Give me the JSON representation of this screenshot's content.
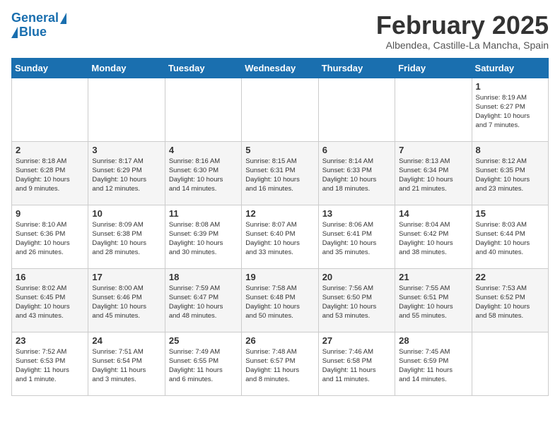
{
  "header": {
    "logo_line1": "General",
    "logo_line2": "Blue",
    "month": "February 2025",
    "location": "Albendea, Castille-La Mancha, Spain"
  },
  "days_of_week": [
    "Sunday",
    "Monday",
    "Tuesday",
    "Wednesday",
    "Thursday",
    "Friday",
    "Saturday"
  ],
  "weeks": [
    [
      {
        "day": "",
        "info": ""
      },
      {
        "day": "",
        "info": ""
      },
      {
        "day": "",
        "info": ""
      },
      {
        "day": "",
        "info": ""
      },
      {
        "day": "",
        "info": ""
      },
      {
        "day": "",
        "info": ""
      },
      {
        "day": "1",
        "info": "Sunrise: 8:19 AM\nSunset: 6:27 PM\nDaylight: 10 hours\nand 7 minutes."
      }
    ],
    [
      {
        "day": "2",
        "info": "Sunrise: 8:18 AM\nSunset: 6:28 PM\nDaylight: 10 hours\nand 9 minutes."
      },
      {
        "day": "3",
        "info": "Sunrise: 8:17 AM\nSunset: 6:29 PM\nDaylight: 10 hours\nand 12 minutes."
      },
      {
        "day": "4",
        "info": "Sunrise: 8:16 AM\nSunset: 6:30 PM\nDaylight: 10 hours\nand 14 minutes."
      },
      {
        "day": "5",
        "info": "Sunrise: 8:15 AM\nSunset: 6:31 PM\nDaylight: 10 hours\nand 16 minutes."
      },
      {
        "day": "6",
        "info": "Sunrise: 8:14 AM\nSunset: 6:33 PM\nDaylight: 10 hours\nand 18 minutes."
      },
      {
        "day": "7",
        "info": "Sunrise: 8:13 AM\nSunset: 6:34 PM\nDaylight: 10 hours\nand 21 minutes."
      },
      {
        "day": "8",
        "info": "Sunrise: 8:12 AM\nSunset: 6:35 PM\nDaylight: 10 hours\nand 23 minutes."
      }
    ],
    [
      {
        "day": "9",
        "info": "Sunrise: 8:10 AM\nSunset: 6:36 PM\nDaylight: 10 hours\nand 26 minutes."
      },
      {
        "day": "10",
        "info": "Sunrise: 8:09 AM\nSunset: 6:38 PM\nDaylight: 10 hours\nand 28 minutes."
      },
      {
        "day": "11",
        "info": "Sunrise: 8:08 AM\nSunset: 6:39 PM\nDaylight: 10 hours\nand 30 minutes."
      },
      {
        "day": "12",
        "info": "Sunrise: 8:07 AM\nSunset: 6:40 PM\nDaylight: 10 hours\nand 33 minutes."
      },
      {
        "day": "13",
        "info": "Sunrise: 8:06 AM\nSunset: 6:41 PM\nDaylight: 10 hours\nand 35 minutes."
      },
      {
        "day": "14",
        "info": "Sunrise: 8:04 AM\nSunset: 6:42 PM\nDaylight: 10 hours\nand 38 minutes."
      },
      {
        "day": "15",
        "info": "Sunrise: 8:03 AM\nSunset: 6:44 PM\nDaylight: 10 hours\nand 40 minutes."
      }
    ],
    [
      {
        "day": "16",
        "info": "Sunrise: 8:02 AM\nSunset: 6:45 PM\nDaylight: 10 hours\nand 43 minutes."
      },
      {
        "day": "17",
        "info": "Sunrise: 8:00 AM\nSunset: 6:46 PM\nDaylight: 10 hours\nand 45 minutes."
      },
      {
        "day": "18",
        "info": "Sunrise: 7:59 AM\nSunset: 6:47 PM\nDaylight: 10 hours\nand 48 minutes."
      },
      {
        "day": "19",
        "info": "Sunrise: 7:58 AM\nSunset: 6:48 PM\nDaylight: 10 hours\nand 50 minutes."
      },
      {
        "day": "20",
        "info": "Sunrise: 7:56 AM\nSunset: 6:50 PM\nDaylight: 10 hours\nand 53 minutes."
      },
      {
        "day": "21",
        "info": "Sunrise: 7:55 AM\nSunset: 6:51 PM\nDaylight: 10 hours\nand 55 minutes."
      },
      {
        "day": "22",
        "info": "Sunrise: 7:53 AM\nSunset: 6:52 PM\nDaylight: 10 hours\nand 58 minutes."
      }
    ],
    [
      {
        "day": "23",
        "info": "Sunrise: 7:52 AM\nSunset: 6:53 PM\nDaylight: 11 hours\nand 1 minute."
      },
      {
        "day": "24",
        "info": "Sunrise: 7:51 AM\nSunset: 6:54 PM\nDaylight: 11 hours\nand 3 minutes."
      },
      {
        "day": "25",
        "info": "Sunrise: 7:49 AM\nSunset: 6:55 PM\nDaylight: 11 hours\nand 6 minutes."
      },
      {
        "day": "26",
        "info": "Sunrise: 7:48 AM\nSunset: 6:57 PM\nDaylight: 11 hours\nand 8 minutes."
      },
      {
        "day": "27",
        "info": "Sunrise: 7:46 AM\nSunset: 6:58 PM\nDaylight: 11 hours\nand 11 minutes."
      },
      {
        "day": "28",
        "info": "Sunrise: 7:45 AM\nSunset: 6:59 PM\nDaylight: 11 hours\nand 14 minutes."
      },
      {
        "day": "",
        "info": ""
      }
    ]
  ]
}
